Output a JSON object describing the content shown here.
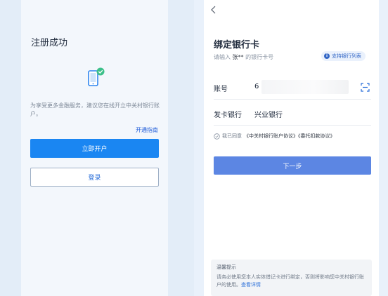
{
  "left": {
    "title": "注册成功",
    "description": "为享受更多金融服务，建议您在线开立中关村银行账户。",
    "guide_link": "开通指南",
    "open_button": "立即开户",
    "login_button": "登录"
  },
  "right": {
    "title": "绑定银行卡",
    "subtitle_prefix": "请输入 ",
    "subtitle_name": "张**",
    "subtitle_suffix": " 的银行卡号",
    "bank_list_button": "支持银行列表",
    "account_label": "账号",
    "account_value_visible": "6",
    "issuer_label": "发卡银行",
    "issuer_value": "兴业银行",
    "agree_prefix": "我已同意",
    "agree_links": "《中关村银行账户协议》《委托扣款协议》",
    "next_button": "下一步",
    "tips_title": "温馨提示",
    "tips_text": "请务必使用您本人实体借记卡进行绑定，否则将影响您中关村银行账户的使用。",
    "tips_link": "查看详情"
  },
  "colors": {
    "primary_blue": "#1a86f2",
    "next_button_blue": "#5c86e3",
    "link_blue": "#2b6fd9",
    "success_green": "#3cc08a"
  },
  "icons": {
    "phone": "phone-success-icon",
    "back": "back-arrow-icon",
    "scan": "scan-card-icon",
    "info": "info-icon",
    "check": "check-circle-icon"
  }
}
